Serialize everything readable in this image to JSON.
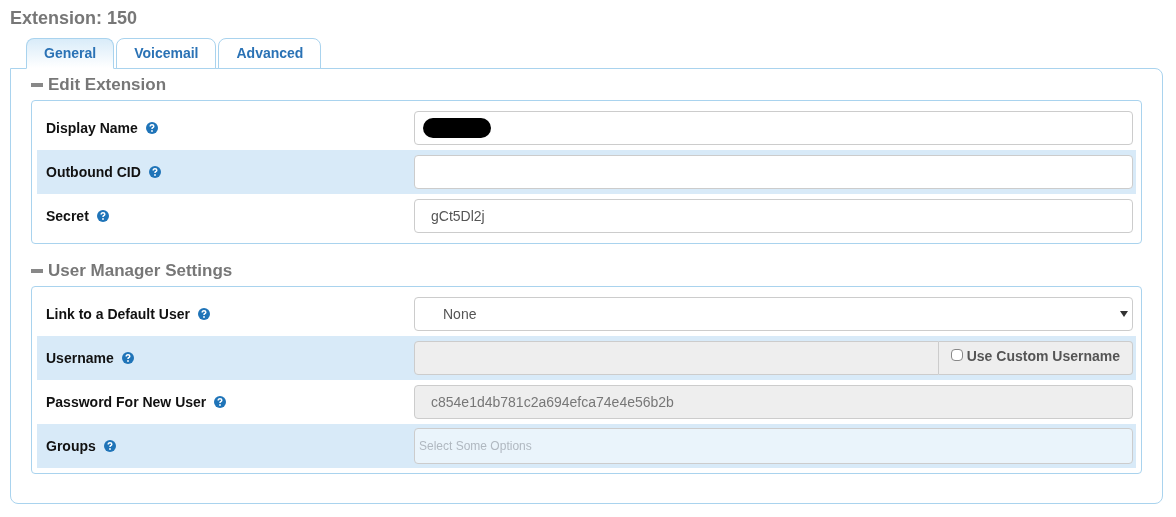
{
  "title": "Extension: 150",
  "tabs": [
    {
      "label": "General",
      "selected": true
    },
    {
      "label": "Voicemail",
      "selected": false
    },
    {
      "label": "Advanced",
      "selected": false
    }
  ],
  "sections": [
    {
      "title": "Edit Extension",
      "expanded": true,
      "rows": [
        {
          "label": "Display Name",
          "kind": "text",
          "redacted": true
        },
        {
          "label": "Outbound CID",
          "kind": "text",
          "value": ""
        },
        {
          "label": "Secret",
          "kind": "text",
          "value": "gCt5Dl2j"
        }
      ]
    },
    {
      "title": "User Manager Settings",
      "expanded": true,
      "rows": [
        {
          "label": "Link to a Default User",
          "kind": "select",
          "value": "None"
        },
        {
          "label": "Username",
          "kind": "addon",
          "disabled": true,
          "addon": {
            "label": "Use Custom Username",
            "checked": false
          }
        },
        {
          "label": "Password For New User",
          "kind": "text",
          "disabled": true,
          "value": "c854e1d4b781c2a694efca74e4e56b2b"
        },
        {
          "label": "Groups",
          "kind": "multiselect",
          "placeholder": "Select Some Options"
        }
      ]
    }
  ]
}
